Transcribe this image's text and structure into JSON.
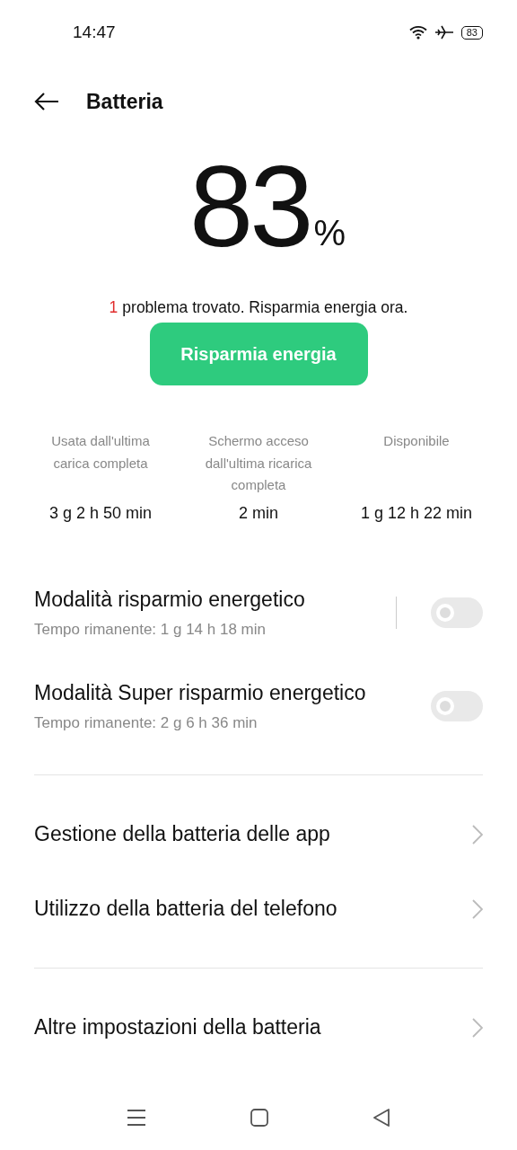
{
  "status_bar": {
    "time": "14:47",
    "battery": "83"
  },
  "header": {
    "title": "Batteria"
  },
  "level": {
    "value": "83",
    "unit": "%"
  },
  "problem": {
    "count": "1",
    "text": "problema trovato. Risparmia energia ora."
  },
  "action_button": "Risparmia energia",
  "stats": [
    {
      "label": "Usata dall'ultima carica completa",
      "value": "3 g 2 h 50 min"
    },
    {
      "label": "Schermo acceso dall'ultima ricarica completa",
      "value": "2 min"
    },
    {
      "label": "Disponibile",
      "value": "1 g 12 h 22 min"
    }
  ],
  "modes": [
    {
      "title": "Modalità risparmio energetico",
      "subtitle": "Tempo rimanente:  1 g 14 h 18 min",
      "on": false,
      "separator": true
    },
    {
      "title": "Modalità Super risparmio energetico",
      "subtitle": "Tempo rimanente:  2 g 6 h 36 min",
      "on": false,
      "separator": false
    }
  ],
  "links": [
    "Gestione della batteria delle app",
    "Utilizzo della batteria del telefono"
  ],
  "more_links": [
    "Altre impostazioni della batteria"
  ]
}
